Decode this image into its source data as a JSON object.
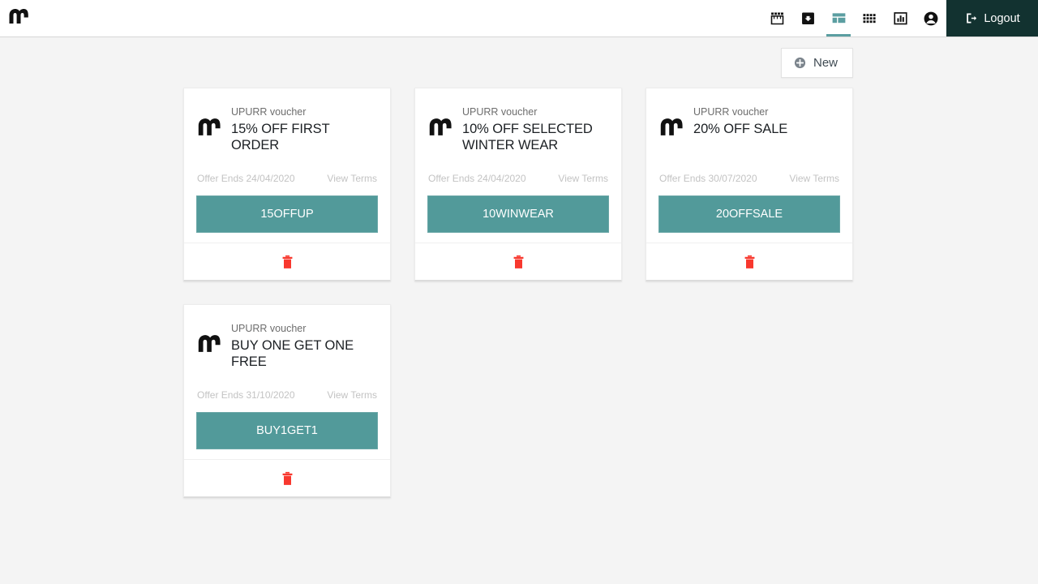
{
  "header": {
    "brand_logo_icon": "upurr-m-logo",
    "nav_items": [
      {
        "icon": "storefront-icon",
        "name": "nav-storefront",
        "active": false
      },
      {
        "icon": "inbox-archive-icon",
        "name": "nav-inbox",
        "active": false
      },
      {
        "icon": "dashboard-layout-icon",
        "name": "nav-dashboard",
        "active": true
      },
      {
        "icon": "grid-apps-icon",
        "name": "nav-apps",
        "active": false
      },
      {
        "icon": "bar-chart-icon",
        "name": "nav-analytics",
        "active": false
      },
      {
        "icon": "account-circle-icon",
        "name": "nav-account",
        "active": false
      }
    ],
    "logout_label": "Logout",
    "logout_icon": "exit-icon"
  },
  "toolbar": {
    "new_label": "New",
    "new_icon": "plus-circle-icon"
  },
  "colors": {
    "teal_button": "#529a9a",
    "logout_bg": "#123230",
    "page_bg": "#f4f4f4",
    "trash_red": "#f8382e",
    "active_underline": "#5b9ea1"
  },
  "vouchers": [
    {
      "kind": "UPURR voucher",
      "title": "15% OFF FIRST ORDER",
      "offer_ends": "Offer Ends 24/04/2020",
      "terms_label": "View Terms",
      "code": "15OFFUP",
      "logo_icon": "upurr-m-logo",
      "delete_icon": "trash-icon"
    },
    {
      "kind": "UPURR voucher",
      "title": "10% OFF SELECTED WINTER WEAR",
      "offer_ends": "Offer Ends 24/04/2020",
      "terms_label": "View Terms",
      "code": "10WINWEAR",
      "logo_icon": "upurr-m-logo",
      "delete_icon": "trash-icon"
    },
    {
      "kind": "UPURR voucher",
      "title": "20% OFF SALE",
      "offer_ends": "Offer Ends 30/07/2020",
      "terms_label": "View Terms",
      "code": "20OFFSALE",
      "logo_icon": "upurr-m-logo",
      "delete_icon": "trash-icon"
    },
    {
      "kind": "UPURR voucher",
      "title": "BUY ONE GET ONE FREE",
      "offer_ends": "Offer Ends 31/10/2020",
      "terms_label": "View Terms",
      "code": "BUY1GET1",
      "logo_icon": "upurr-m-logo",
      "delete_icon": "trash-icon"
    }
  ]
}
